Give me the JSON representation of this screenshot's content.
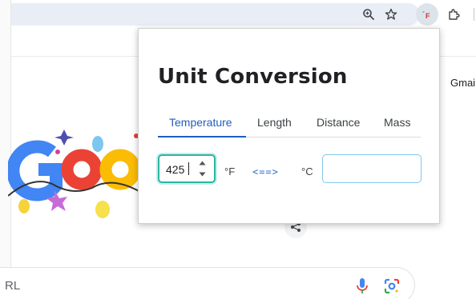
{
  "browser": {
    "toolbar": {
      "icons": [
        "zoom-icon",
        "star-icon",
        "converter-extension-icon",
        "puzzle-icon"
      ]
    }
  },
  "google_page": {
    "gmail_link": "Gmai",
    "search_hint": "RL",
    "icons": [
      "mic-icon",
      "lens-icon",
      "share-icon"
    ]
  },
  "popup": {
    "title": "Unit Conversion",
    "tabs": [
      {
        "label": "Temperature",
        "active": true
      },
      {
        "label": "Length",
        "active": false
      },
      {
        "label": "Distance",
        "active": false
      },
      {
        "label": "Mass",
        "active": false
      }
    ],
    "converter": {
      "input_value": "425",
      "from_unit": "°F",
      "direction_label": "<==>",
      "to_unit": "°C",
      "output_value": ""
    }
  },
  "colors": {
    "accent": "#1f5fbf",
    "input_focus": "#2bb5a3",
    "output_border": "#7fc8e8",
    "omnibox": "#e9eef6"
  }
}
